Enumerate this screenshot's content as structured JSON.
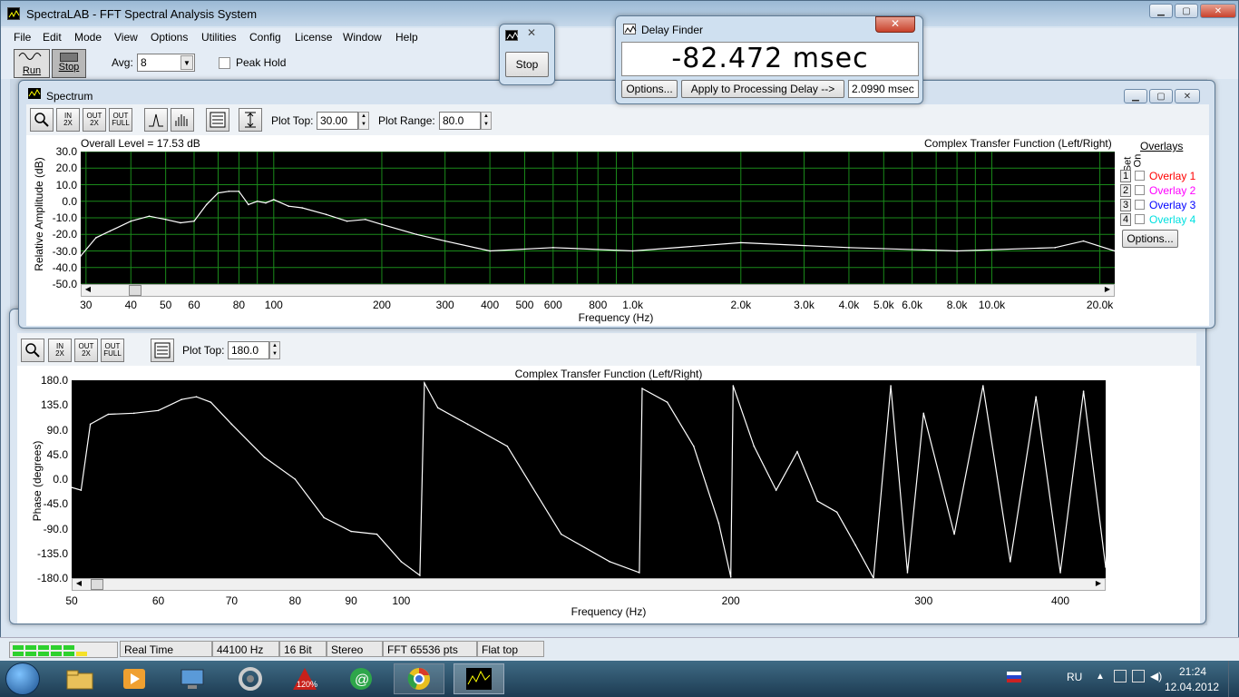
{
  "app": {
    "title": "SpectraLAB - FFT Spectral Analysis System",
    "menu": [
      "File",
      "Edit",
      "Mode",
      "View",
      "Options",
      "Utilities",
      "Config",
      "License",
      "Window",
      "Help"
    ],
    "toolbar": {
      "run_label": "Run",
      "stop_label": "Stop",
      "avg_label": "Avg:",
      "avg_value": "8",
      "peak_hold_label": "Peak Hold"
    }
  },
  "stop_popup": {
    "stop_label": "Stop"
  },
  "delay_finder": {
    "title": "Delay Finder",
    "value": "-82.472 msec",
    "options_label": "Options...",
    "apply_label": "Apply to Processing Delay -->",
    "delay_value": "2.0990 msec"
  },
  "spectrum": {
    "title": "Spectrum",
    "tool_labels": {
      "zin": "IN\n2X",
      "zout": "OUT\n2X",
      "zfull": "OUT\nFULL"
    },
    "plot_top_label": "Plot Top:",
    "plot_top_value": "30.00",
    "plot_range_label": "Plot Range:",
    "plot_range_value": "80.0",
    "overall_level": "Overall Level = 17.53 dB",
    "plot_title": "Complex Transfer Function (Left/Right)",
    "ylabel": "Relative Amplitude (dB)",
    "xlabel": "Frequency (Hz)",
    "yticks": [
      "30.0",
      "20.0",
      "10.0",
      "0.0",
      "-10.0",
      "-20.0",
      "-30.0",
      "-40.0",
      "-50.0"
    ],
    "xticks": [
      "30",
      "40",
      "50",
      "60",
      "80",
      "100",
      "200",
      "300",
      "400",
      "500",
      "600",
      "800",
      "1.0k",
      "2.0k",
      "3.0k",
      "4.0k",
      "5.0k",
      "6.0k",
      "8.0k",
      "10.0k",
      "20.0k"
    ],
    "overlays": {
      "header": "Overlays",
      "set_label": "Set",
      "on_label": "On",
      "items": [
        {
          "num": "1",
          "label": "Overlay 1",
          "color": "#ff0000"
        },
        {
          "num": "2",
          "label": "Overlay 2",
          "color": "#ff00ff"
        },
        {
          "num": "3",
          "label": "Overlay 3",
          "color": "#0000ff"
        },
        {
          "num": "4",
          "label": "Overlay 4",
          "color": "#00e0e0"
        }
      ],
      "options_label": "Options..."
    }
  },
  "phase": {
    "plot_top_label": "Plot Top:",
    "plot_top_value": "180.0",
    "plot_title": "Complex Transfer Function (Left/Right)",
    "ylabel": "Phase (degrees)",
    "xlabel": "Frequency (Hz)",
    "yticks": [
      "180.0",
      "135.0",
      "90.0",
      "45.0",
      "0.0",
      "-45.0",
      "-90.0",
      "-135.0",
      "-180.0"
    ],
    "xticks": [
      "50",
      "60",
      "70",
      "80",
      "90",
      "100",
      "200",
      "300",
      "400"
    ]
  },
  "chart_data": [
    {
      "type": "line",
      "title": "Complex Transfer Function (Left/Right)",
      "xlabel": "Frequency (Hz)",
      "ylabel": "Relative Amplitude (dB)",
      "xscale": "log",
      "xlim": [
        29,
        22000
      ],
      "ylim": [
        -50,
        30
      ],
      "grid": true,
      "x": [
        29,
        32,
        35,
        40,
        45,
        50,
        55,
        60,
        65,
        70,
        75,
        80,
        85,
        90,
        95,
        100,
        110,
        120,
        140,
        160,
        180,
        200,
        250,
        300,
        400,
        600,
        1000,
        2000,
        4000,
        8000,
        15000,
        18000,
        22000
      ],
      "y": [
        -33,
        -22,
        -18,
        -12,
        -9,
        -11,
        -13,
        -12,
        -2,
        5,
        6,
        6,
        -2,
        0,
        -1,
        1,
        -3,
        -4,
        -8,
        -12,
        -11,
        -14,
        -20,
        -24,
        -30,
        -28,
        -30,
        -25,
        -28,
        -30,
        -28,
        -24,
        -30
      ]
    },
    {
      "type": "line",
      "title": "Complex Transfer Function (Left/Right)",
      "xlabel": "Frequency (Hz)",
      "ylabel": "Phase (degrees)",
      "xscale": "log",
      "xlim": [
        50,
        440
      ],
      "ylim": [
        -180,
        180
      ],
      "grid": false,
      "x": [
        50,
        51,
        52,
        54,
        57,
        60,
        63,
        65,
        67,
        70,
        75,
        80,
        85,
        90,
        95,
        100,
        104,
        105,
        108,
        115,
        125,
        140,
        155,
        165,
        166,
        175,
        185,
        195,
        200,
        201,
        210,
        220,
        230,
        240,
        250,
        260,
        270,
        280,
        290,
        300,
        320,
        340,
        360,
        380,
        400,
        420,
        440
      ],
      "y": [
        -15,
        -20,
        100,
        118,
        120,
        125,
        145,
        150,
        140,
        100,
        40,
        0,
        -70,
        -95,
        -100,
        -150,
        -175,
        175,
        130,
        100,
        60,
        -100,
        -150,
        -170,
        165,
        140,
        60,
        -80,
        -178,
        170,
        60,
        -20,
        50,
        -40,
        -60,
        -120,
        -180,
        170,
        -170,
        120,
        -100,
        170,
        -150,
        150,
        -170,
        160,
        -160
      ]
    }
  ],
  "status_bar": [
    "Real Time",
    "44100 Hz",
    "16 Bit",
    "Stereo",
    "FFT 65536 pts",
    "Flat top"
  ],
  "taskbar": {
    "language": "RU",
    "time": "21:24",
    "date": "12.04.2012"
  }
}
